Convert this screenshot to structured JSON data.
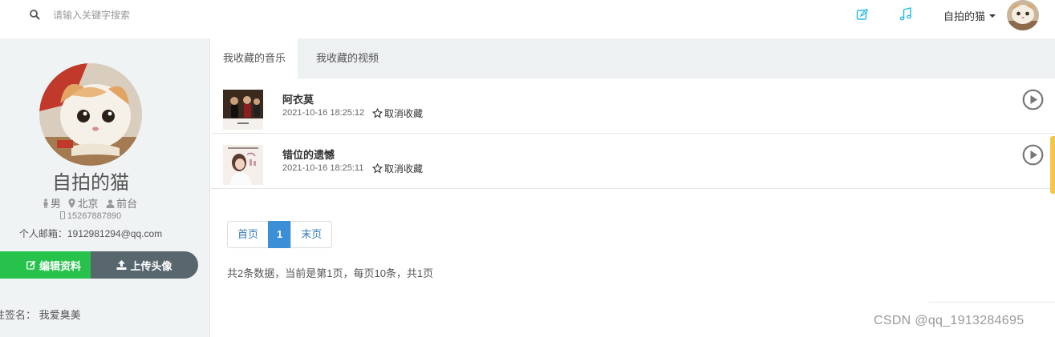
{
  "search": {
    "placeholder": "请输入关键字搜索"
  },
  "header": {
    "username": "自拍的猫"
  },
  "profile": {
    "name": "自拍的猫",
    "gender": "男",
    "city": "北京",
    "role": "前台",
    "phone": "15267887890",
    "email_label": "个人邮箱：",
    "email": "1912981294@qq.com",
    "edit_label": "编辑资料",
    "upload_label": "上传头像",
    "signature_label": "性签名：",
    "signature": "我爱臭美"
  },
  "tabs": [
    {
      "label": "我收藏的音乐",
      "active": true
    },
    {
      "label": "我收藏的视频",
      "active": false
    }
  ],
  "songs": [
    {
      "title": "阿衣莫",
      "date": "2021-10-16 18:25:12",
      "action": "取消收藏"
    },
    {
      "title": "错位的遗憾",
      "date": "2021-10-16 18:25:11",
      "action": "取消收藏"
    }
  ],
  "pagination": {
    "first": "首页",
    "current": "1",
    "last": "末页"
  },
  "page_info": "共2条数据，当前是第1页，每页10条，共1页",
  "watermark": "CSDN @qq_1913284695",
  "colors": {
    "accent_green": "#27c24c",
    "accent_dark": "#58666e",
    "accent_blue": "#3a8fd6",
    "icon_teal": "#23b7e5"
  },
  "icons": [
    "search-icon",
    "edit-icon",
    "music-icon",
    "male-icon",
    "map-marker-icon",
    "user-icon",
    "mobile-icon",
    "star-icon",
    "play-circle-icon",
    "upload-icon"
  ]
}
